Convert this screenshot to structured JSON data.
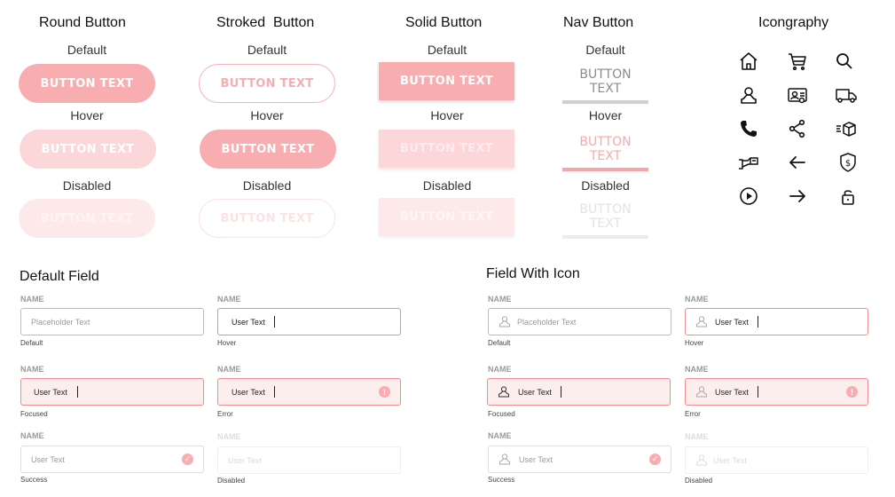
{
  "sections": {
    "round": "Round Button",
    "stroked": "Stroked  Button",
    "solid": "Solid Button",
    "nav": "Nav Button",
    "icons": "Icongraphy",
    "default_field": "Default Field",
    "icon_field": "Field With Icon"
  },
  "states": {
    "default": "Default",
    "hover": "Hover",
    "disabled": "Disabled"
  },
  "button_label": "BUTTON TEXT",
  "colors": {
    "accent": "#f8adb1",
    "accent_light": "#fcd7d9",
    "accent_faint": "#fde9ea",
    "error_bg": "#fdeeee",
    "error_border": "#f08b90"
  },
  "icons": [
    "home-icon",
    "cart-icon",
    "search-icon",
    "user-icon",
    "id-card-icon",
    "delivery-truck-icon",
    "phone-icon",
    "share-icon",
    "fast-box-icon",
    "payment-hand-icon",
    "arrow-left-icon",
    "dollar-shield-icon",
    "play-icon",
    "arrow-right-icon",
    "lock-icon"
  ],
  "field_label": "NAME",
  "fields": {
    "placeholder": "Placeholder Text",
    "user_text": "User Text",
    "help": {
      "default": "Default",
      "hover": "Hover",
      "focused": "Focused",
      "error": "Error",
      "success": "Success",
      "disabled": "Disabled"
    },
    "status": {
      "error": "!",
      "success": "✓"
    }
  }
}
